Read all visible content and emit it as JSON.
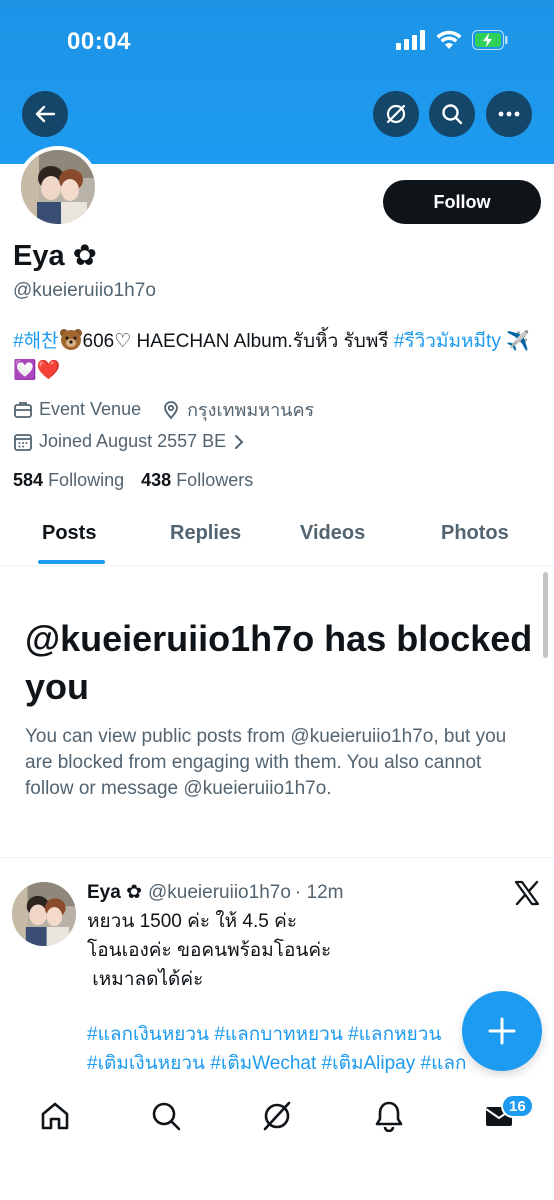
{
  "status_bar": {
    "time": "00:04"
  },
  "profile": {
    "name": "Eya ✿",
    "handle": "@kueieruiio1h7o",
    "bio": {
      "tag1": "#해찬",
      "text1": "606♡ HAECHAN Album.รับหิ้ว รับพรี ",
      "tag2": "#รีวิวมัมหมีty",
      "emojis": "✈️💟❤️"
    },
    "category": "Event Venue",
    "location": "กรุงเทพมหานคร",
    "joined": "Joined August 2557 BE",
    "following_count": "584",
    "following_label": "Following",
    "followers_count": "438",
    "followers_label": "Followers",
    "follow_button": "Follow"
  },
  "tabs": [
    "Posts",
    "Replies",
    "Videos",
    "Photos"
  ],
  "blocked": {
    "title": "@kueieruiio1h7o has blocked you",
    "description": "You can view public posts from @kueieruiio1h7o, but you are blocked from engaging with them. You also cannot follow or message @kueieruiio1h7o."
  },
  "post": {
    "author": "Eya ✿",
    "handle": "@kueieruiio1h7o",
    "time": "· 12m",
    "line1": "หยวน 1500 ค่ะ ให้ 4.5 ค่ะ",
    "line2": "โอนเองค่ะ ขอคนพร้อมโอนค่ะ",
    "line3": " เหมาลดได้ค่ะ",
    "tags": "#แลกเงินหยวน #แลกบาทหยวน #แลกหยวน #เติมเงินหยวน #เติมWechat #เติมAlipay #แลกเงินหยวน"
  },
  "nav": {
    "messages_badge": "16"
  },
  "colors": {
    "accent": "#1d9bf0",
    "text": "#0f1419",
    "secondary": "#536471"
  }
}
